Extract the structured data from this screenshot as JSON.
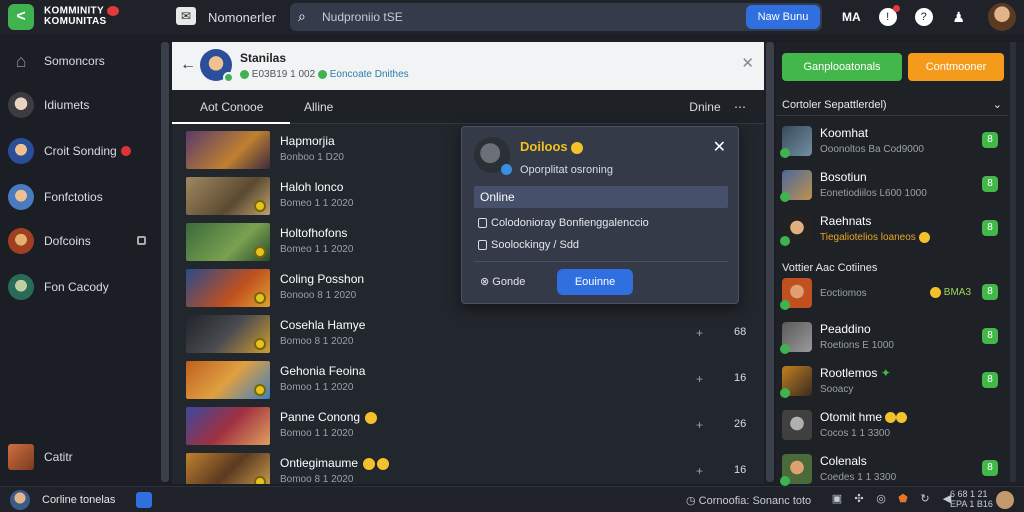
{
  "topbar": {
    "logo_text_1": "KOMMINITY",
    "logo_text_2": "KOMUNITAS",
    "notif_label": "Nomonerler",
    "search_placeholder": "Nudproniio tSE",
    "search_button": "Naw Bunu",
    "menu_label": "MA"
  },
  "sidebar": {
    "items": [
      {
        "label": "Somoncors"
      },
      {
        "label": "Idiumets"
      },
      {
        "label": "Croit Sonding"
      },
      {
        "label": "Fonfctotios"
      },
      {
        "label": "Dofcoins"
      },
      {
        "label": "Fon Cacody"
      },
      {
        "label": "Catitr"
      }
    ]
  },
  "chat": {
    "title": "Stanilas",
    "sub_text": "E03B19 1 002",
    "sub_teal": "Eoncoate Dnithes",
    "tabs": [
      "Aot Conooe",
      "Alline"
    ],
    "tab_more": "Dnine",
    "rows": [
      {
        "name": "Hapmorjia",
        "date": "Bonboo 1 D20",
        "plus": "",
        "count": ""
      },
      {
        "name": "Haloh lonco",
        "date": "Bomeo 1 1 2020",
        "plus": "",
        "count": ""
      },
      {
        "name": "Holtofhofons",
        "date": "Bomeo 1 1 2020",
        "plus": "",
        "count": ""
      },
      {
        "name": "Coling Posshon",
        "date": "Bonooo 8 1 2020",
        "plus": "",
        "count": ""
      },
      {
        "name": "Cosehla Hamye",
        "date": "Bomoo 8 1 2020",
        "plus": "+",
        "count": "68"
      },
      {
        "name": "Gehonia Feoina",
        "date": "Bomoo 1 1 2020",
        "plus": "+",
        "count": "16"
      },
      {
        "name": "Panne Conong",
        "date": "Bomoo 1 1 2020",
        "plus": "+",
        "count": "26"
      },
      {
        "name": "Ontiegimaume",
        "date": "Bomoo 8 1 2020",
        "plus": "+",
        "count": "16"
      }
    ]
  },
  "popup": {
    "name": "Doiloos",
    "status": "Oporplitat osroning",
    "online": "Online",
    "options": [
      "Colodonioray Bonfienggalenccio",
      "Soolockingy / Sdd"
    ],
    "cancel": "Gonde",
    "confirm": "Eouinne"
  },
  "right": {
    "btn_green": "Ganplooatonals",
    "btn_orange": "Contmooner",
    "header": "Cortoler Sepattlerdel)",
    "section_label": "Vottier Aac Cotiines",
    "items": [
      {
        "name": "Koomhat",
        "date": "Ooonoltos  Ba Cod9000",
        "count": ""
      },
      {
        "name": "Bosotiun",
        "date": "Eonetiodiilos L600 1000",
        "count": ""
      },
      {
        "name": "Raehnats",
        "date": "Tiegaliotelios loaneos",
        "count": ""
      },
      {
        "name": "",
        "date": "Eoctiomos",
        "count": "BMA3"
      },
      {
        "name": "Peaddino",
        "date": "Roetions E 1000",
        "count": ""
      },
      {
        "name": "Rootlemos",
        "date": "Sooacy",
        "count": ""
      },
      {
        "name": "Otomit hme",
        "date": "Cocos 1 1 3300",
        "count": ""
      },
      {
        "name": "Colenals",
        "date": "Coedes 1 1 3300",
        "count": ""
      }
    ]
  },
  "bottom": {
    "label": "Corline tonelas",
    "status": "Cornoofia: Sonanc toto",
    "time_1": "6 68 1 21",
    "time_2": "EPA 1 B16"
  }
}
